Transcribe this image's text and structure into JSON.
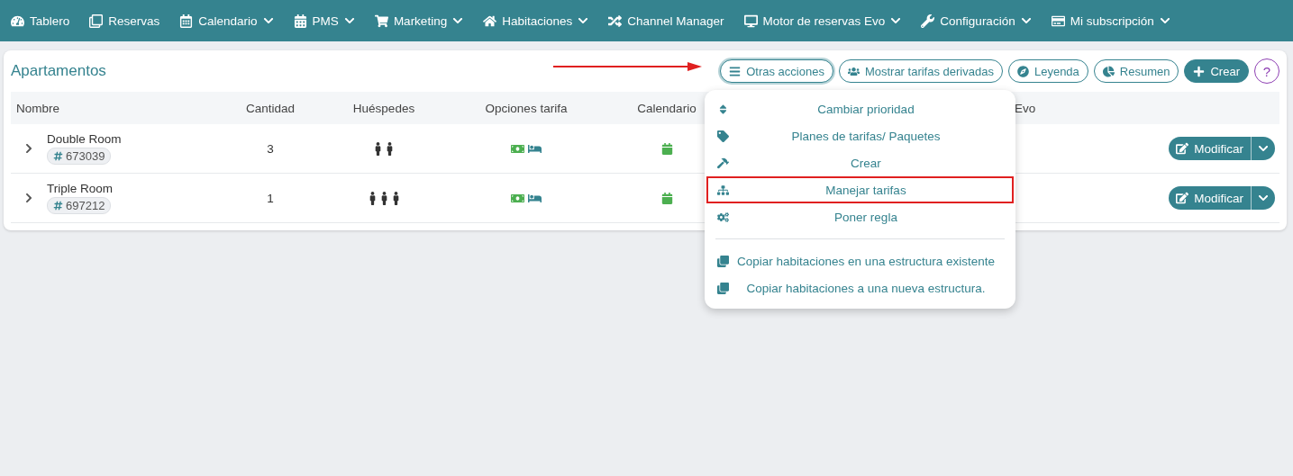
{
  "nav": [
    {
      "label": "Tablero",
      "dropdown": false
    },
    {
      "label": "Reservas",
      "dropdown": false
    },
    {
      "label": "Calendario",
      "dropdown": true
    },
    {
      "label": "PMS",
      "dropdown": true
    },
    {
      "label": "Marketing",
      "dropdown": true
    },
    {
      "label": "Habitaciones",
      "dropdown": true
    },
    {
      "label": "Channel Manager",
      "dropdown": false
    },
    {
      "label": "Motor de reservas Evo",
      "dropdown": true
    },
    {
      "label": "Configuración",
      "dropdown": true
    },
    {
      "label": "Mi subscripción",
      "dropdown": true
    }
  ],
  "panel": {
    "title": "Apartamentos",
    "toolbar": [
      {
        "kind": "outline",
        "label": "Otras acciones",
        "expanded": true
      },
      {
        "kind": "outline",
        "label": "Mostrar tarifas derivadas",
        "expanded": false
      },
      {
        "kind": "outline",
        "label": "Leyenda",
        "expanded": false
      },
      {
        "kind": "outline",
        "label": "Resumen",
        "expanded": false
      },
      {
        "kind": "solid",
        "label": "Crear",
        "expanded": false
      },
      {
        "kind": "help",
        "label": "?",
        "expanded": false
      }
    ],
    "columns": [
      "Nombre",
      "Cantidad",
      "Huéspedes",
      "Opciones tarifa",
      "Calendario",
      "Evo"
    ],
    "rows": [
      {
        "name": "Double Room",
        "id": "673039",
        "quantity": "3",
        "guests": [
          {
            "kind": "person"
          },
          {
            "kind": "person"
          }
        ],
        "action": "Modificar"
      },
      {
        "name": "Triple Room",
        "id": "697212",
        "quantity": "1",
        "guests": [
          {
            "kind": "person"
          },
          {
            "kind": "person"
          },
          {
            "kind": "person"
          }
        ],
        "action": "Modificar"
      }
    ]
  },
  "menu": {
    "sections": [
      [
        {
          "label": "Cambiar prioridad",
          "highlighted": false
        },
        {
          "label": "Planes de tarifas/ Paquetes",
          "highlighted": false
        },
        {
          "label": "Crear",
          "highlighted": false
        },
        {
          "label": "Manejar tarifas",
          "highlighted": true
        },
        {
          "label": "Poner regla",
          "highlighted": false
        }
      ],
      [
        {
          "label": "Copiar habitaciones en una estructura existente",
          "highlighted": false
        },
        {
          "label": "Copiar habitaciones a una nueva estructura.",
          "highlighted": false
        }
      ]
    ]
  }
}
